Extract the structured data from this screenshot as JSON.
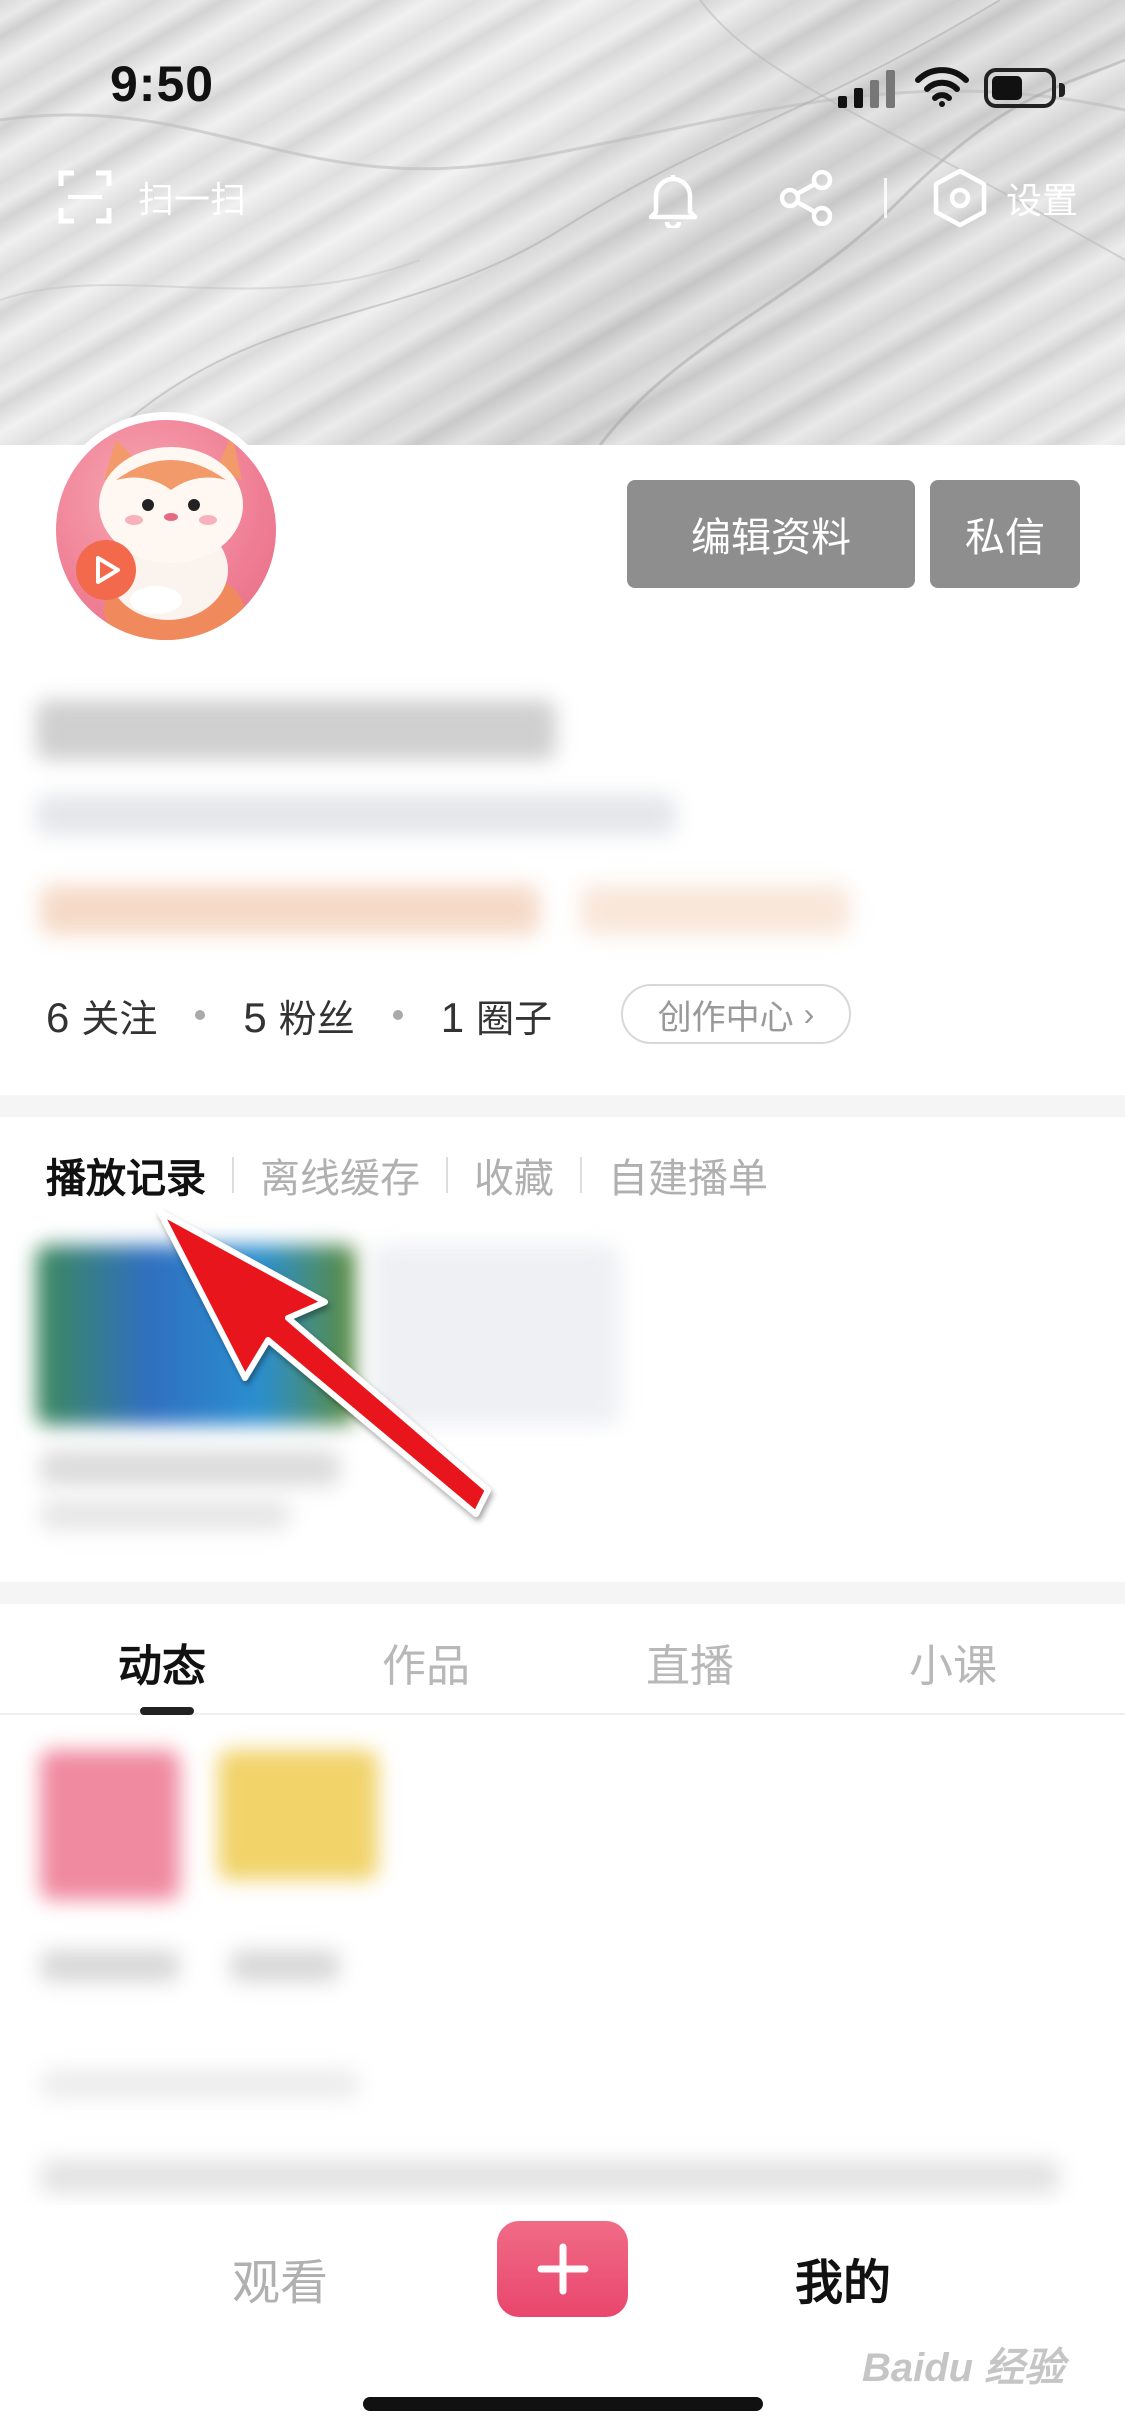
{
  "status_bar": {
    "time": "9:50"
  },
  "top_nav": {
    "scan_label": "扫一扫",
    "settings_label": "设置"
  },
  "profile": {
    "edit_button": "编辑资料",
    "message_button": "私信",
    "stats": {
      "following_count": "6",
      "following_label": "关注",
      "fans_count": "5",
      "fans_label": "粉丝",
      "circles_count": "1",
      "circles_label": "圈子"
    },
    "creator_center_label": "创作中心",
    "creator_center_chevron": "›"
  },
  "history_tabs": [
    {
      "label": "播放记录",
      "active": true
    },
    {
      "label": "离线缓存",
      "active": false
    },
    {
      "label": "收藏",
      "active": false
    },
    {
      "label": "自建播单",
      "active": false
    }
  ],
  "content_tabs": [
    {
      "label": "动态",
      "active": true
    },
    {
      "label": "作品",
      "active": false
    },
    {
      "label": "直播",
      "active": false
    },
    {
      "label": "小课",
      "active": false
    }
  ],
  "bottom_nav": {
    "watch_label": "观看",
    "mine_label": "我的",
    "plus_icon": "plus-icon"
  },
  "watermark": "Baidu 经验",
  "colors": {
    "accent_pink": "#e9466d",
    "button_gray": "#8e8e8e",
    "annotation_arrow": "#e8141c"
  }
}
